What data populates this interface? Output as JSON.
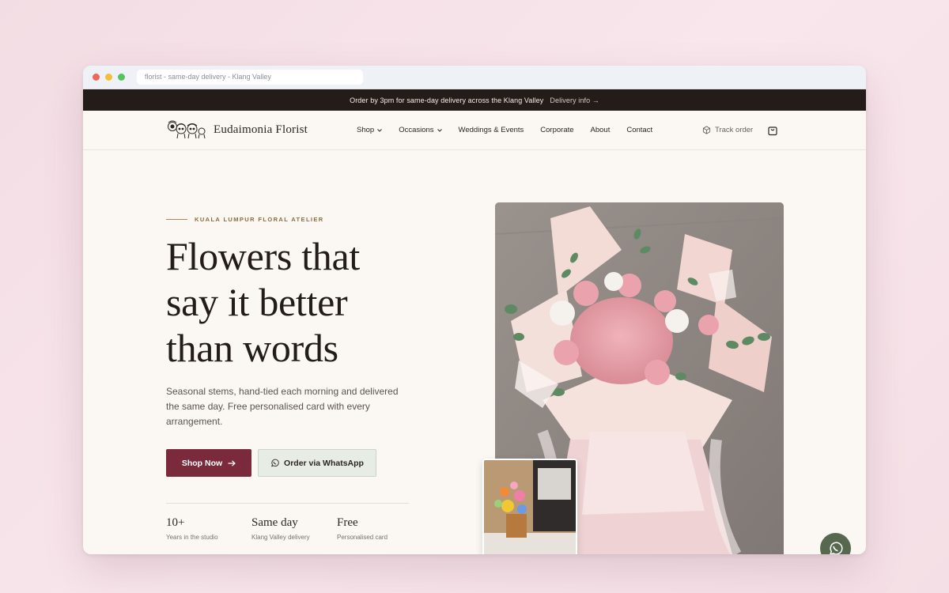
{
  "browser": {
    "url": "florist - same-day delivery - Klang Valley"
  },
  "announcement": {
    "text": "Order by 3pm for same-day delivery across the Klang Valley",
    "link": "Delivery info →"
  },
  "nav": {
    "brand": "Eudaimonia Florist",
    "items": [
      {
        "label": "Shop"
      },
      {
        "label": "Occasions"
      },
      {
        "label": "Weddings & Events"
      },
      {
        "label": "Corporate"
      },
      {
        "label": "About"
      },
      {
        "label": "Contact"
      }
    ],
    "track_order": "Track order"
  },
  "hero": {
    "eyebrow": "KUALA LUMPUR FLORAL ATELIER",
    "headline_line1": "Flowers that",
    "headline_line2": "say it better",
    "headline_line3": "than words",
    "subtext": "Seasonal stems, hand-tied each morning and delivered the same day. Free personalised card with every arrangement.",
    "primary_cta": "Shop Now",
    "secondary_cta": "Order via WhatsApp",
    "stats": [
      {
        "value": "10+",
        "label": "Years in the studio"
      },
      {
        "value": "Same day",
        "label": "Klang Valley delivery"
      },
      {
        "value": "Free",
        "label": "Personalised card"
      }
    ]
  },
  "colors": {
    "primary": "#7b2a3b",
    "announcement_bg": "#231c19",
    "eyebrow": "#8c6b3f",
    "whatsapp_float": "#56694f"
  }
}
